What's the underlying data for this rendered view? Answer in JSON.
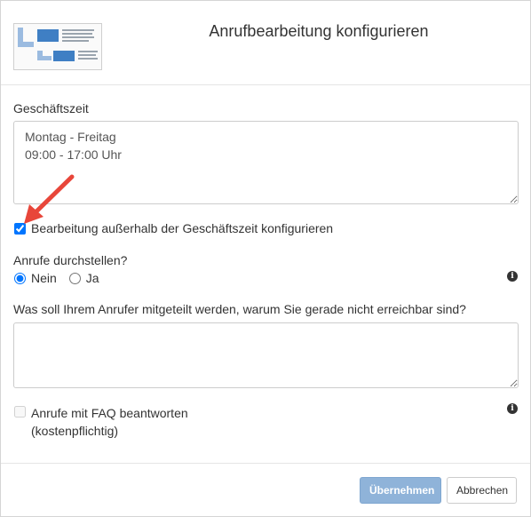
{
  "dialog": {
    "title": "Anrufbearbeitung konfigurieren"
  },
  "business_hours": {
    "label": "Geschäftszeit",
    "value": "Montag - Freitag\n09:00 - 17:00 Uhr"
  },
  "outside_hours": {
    "label": "Bearbeitung außerhalb der Geschäftszeit konfigurieren",
    "checked": true
  },
  "forward_calls": {
    "label": "Anrufe durchstellen?",
    "options": [
      "Nein",
      "Ja"
    ],
    "selected": "Nein"
  },
  "message": {
    "label": "Was soll Ihrem Anrufer mitgeteilt werden, warum Sie gerade nicht erreichbar sind?",
    "value": ""
  },
  "faq": {
    "label_line1": "Anrufe mit FAQ beantworten",
    "label_line2": "(kostenpflichtig)",
    "checked": false
  },
  "footer": {
    "apply_label": "Übernehmen",
    "cancel_label": "Abbrechen"
  },
  "annotation": {
    "arrow_color": "#e8463a"
  },
  "icons": {
    "info": "info-circle-icon"
  }
}
